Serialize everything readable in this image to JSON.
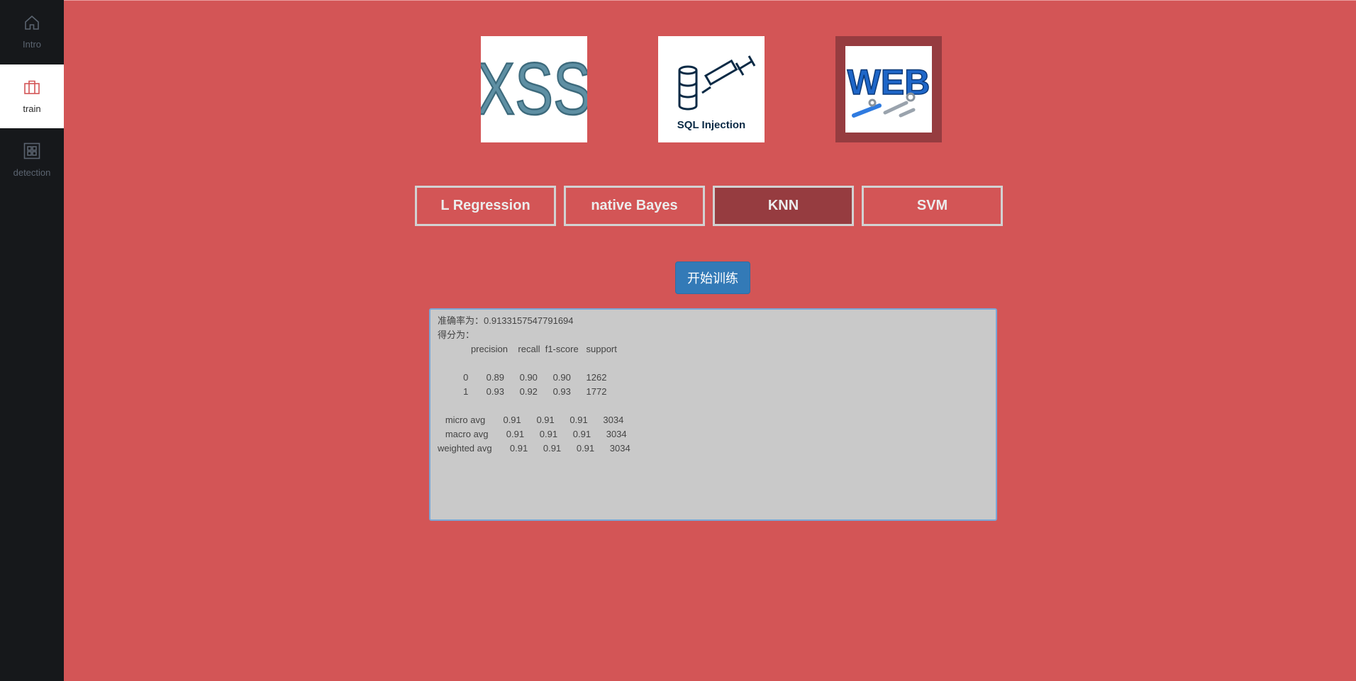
{
  "sidebar": {
    "items": [
      {
        "label": "Intro",
        "icon": "home-icon",
        "active": false
      },
      {
        "label": "train",
        "icon": "briefcase-icon",
        "active": true
      },
      {
        "label": "detection",
        "icon": "grid-icon",
        "active": false
      }
    ]
  },
  "attack_types": [
    {
      "name": "XSS",
      "icon": "xss-image"
    },
    {
      "name": "SQL Injection",
      "icon": "sql-injection-image"
    },
    {
      "name": "WEB",
      "icon": "web-image",
      "selected": true
    }
  ],
  "algorithms": [
    {
      "label": "L Regression",
      "active": false
    },
    {
      "label": "native Bayes",
      "active": false
    },
    {
      "label": "KNN",
      "active": true
    },
    {
      "label": "SVM",
      "active": false
    }
  ],
  "train_button": "开始训练",
  "result": {
    "accuracy_line": "准确率为：0.9133157547791694",
    "score_label": "得分为：",
    "report_lines": [
      "             precision    recall  f1-score   support",
      "",
      "          0       0.89      0.90      0.90      1262",
      "          1       0.93      0.92      0.93      1772",
      "",
      "   micro avg       0.91      0.91      0.91      3034",
      "   macro avg       0.91      0.91      0.91      3034",
      "weighted avg       0.91      0.91      0.91      3034"
    ]
  },
  "colors": {
    "background": "#d35556",
    "sidebar": "#16181b",
    "active_button": "#963c40",
    "train_button": "#337ab7"
  }
}
